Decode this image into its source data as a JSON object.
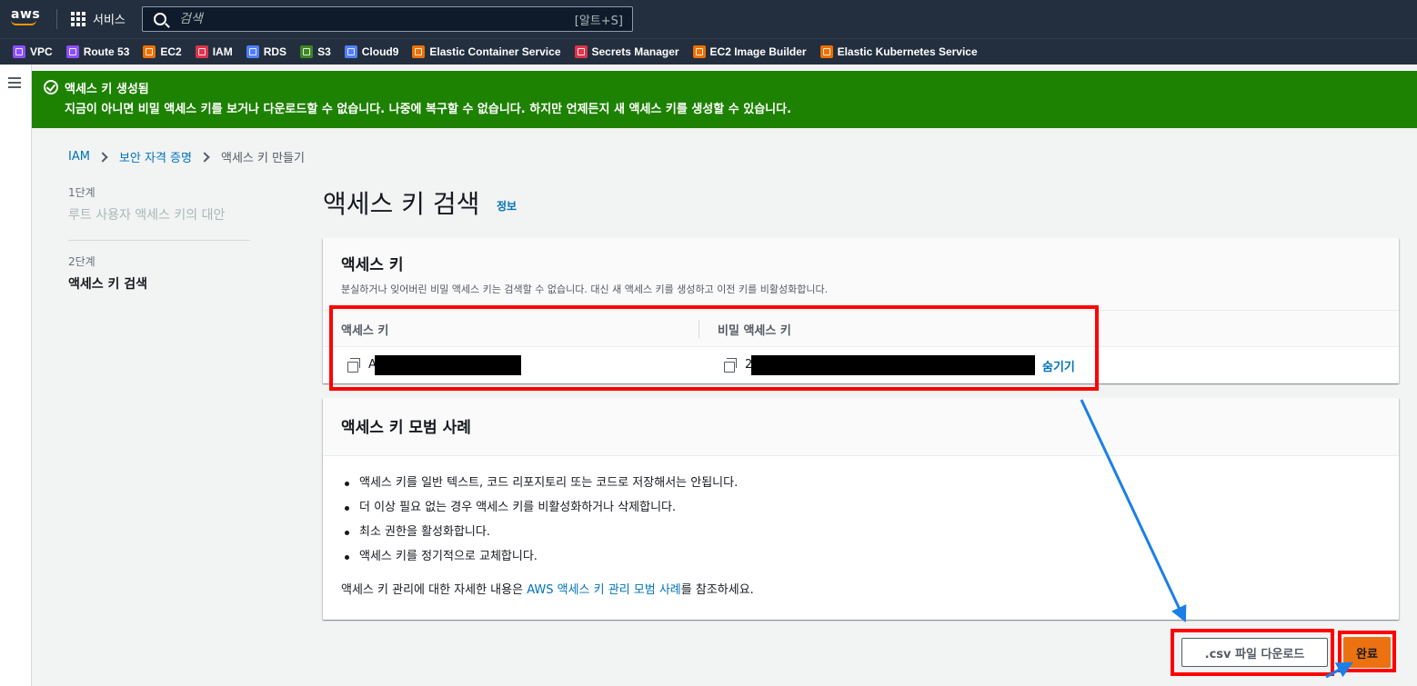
{
  "topnav": {
    "logo": "aws",
    "services_label": "서비스",
    "search_placeholder": "검색",
    "search_shortcut": "[알트+S]"
  },
  "favorites": [
    {
      "label": "VPC",
      "color": "#8c4fff"
    },
    {
      "label": "Route 53",
      "color": "#8c4fff"
    },
    {
      "label": "EC2",
      "color": "#ed7100"
    },
    {
      "label": "IAM",
      "color": "#dd344c"
    },
    {
      "label": "RDS",
      "color": "#527fff"
    },
    {
      "label": "S3",
      "color": "#3f8624"
    },
    {
      "label": "Cloud9",
      "color": "#527fff"
    },
    {
      "label": "Elastic Container Service",
      "color": "#ed7100"
    },
    {
      "label": "Secrets Manager",
      "color": "#dd344c"
    },
    {
      "label": "EC2 Image Builder",
      "color": "#ed7100"
    },
    {
      "label": "Elastic Kubernetes Service",
      "color": "#ed7100"
    }
  ],
  "flash": {
    "title": "액세스 키 생성됨",
    "message": "지금이 아니면 비밀 액세스 키를 보거나 다운로드할 수 없습니다. 나중에 복구할 수 없습니다. 하지만 언제든지 새 액세스 키를 생성할 수 있습니다.",
    "color": "#1d8102"
  },
  "breadcrumb": {
    "items": [
      "IAM",
      "보안 자격 증명"
    ],
    "current": "액세스 키 만들기"
  },
  "steps": [
    {
      "label": "1단계",
      "title": "루트 사용자 액세스 키의 대안"
    },
    {
      "label": "2단계",
      "title": "액세스 키 검색"
    }
  ],
  "page": {
    "title": "액세스 키 검색",
    "info_link": "정보"
  },
  "access_key_panel": {
    "title": "액세스 키",
    "description": "분실하거나 잊어버린 비밀 액세스 키는 검색할 수 없습니다. 대신 새 액세스 키를 생성하고 이전 키를 비활성화합니다.",
    "col_access_key": "액세스 키",
    "col_secret_key": "비밀 액세스 키",
    "access_key_prefix": "A",
    "secret_key_prefix": "2",
    "hide_label": "숨기기"
  },
  "best_practices": {
    "title": "액세스 키 모범 사례",
    "items": [
      "액세스 키를 일반 텍스트, 코드 리포지토리 또는 코드로 저장해서는 안됩니다.",
      "더 이상 필요 없는 경우 액세스 키를 비활성화하거나 삭제합니다.",
      "최소 권한을 활성화합니다.",
      "액세스 키를 정기적으로 교체합니다."
    ],
    "more_before": "액세스 키 관리에 대한 자세한 내용은 ",
    "more_link": "AWS 액세스 키 관리 모범 사례",
    "more_after": "를 참조하세요."
  },
  "actions": {
    "download_csv": ".csv 파일 다운로드",
    "done": "완료"
  },
  "colors": {
    "nav_bg": "#232f3e",
    "link": "#0073bb",
    "primary_button": "#ec7211",
    "annotation_red": "#ff0000",
    "annotation_blue": "#1a7fe8"
  }
}
